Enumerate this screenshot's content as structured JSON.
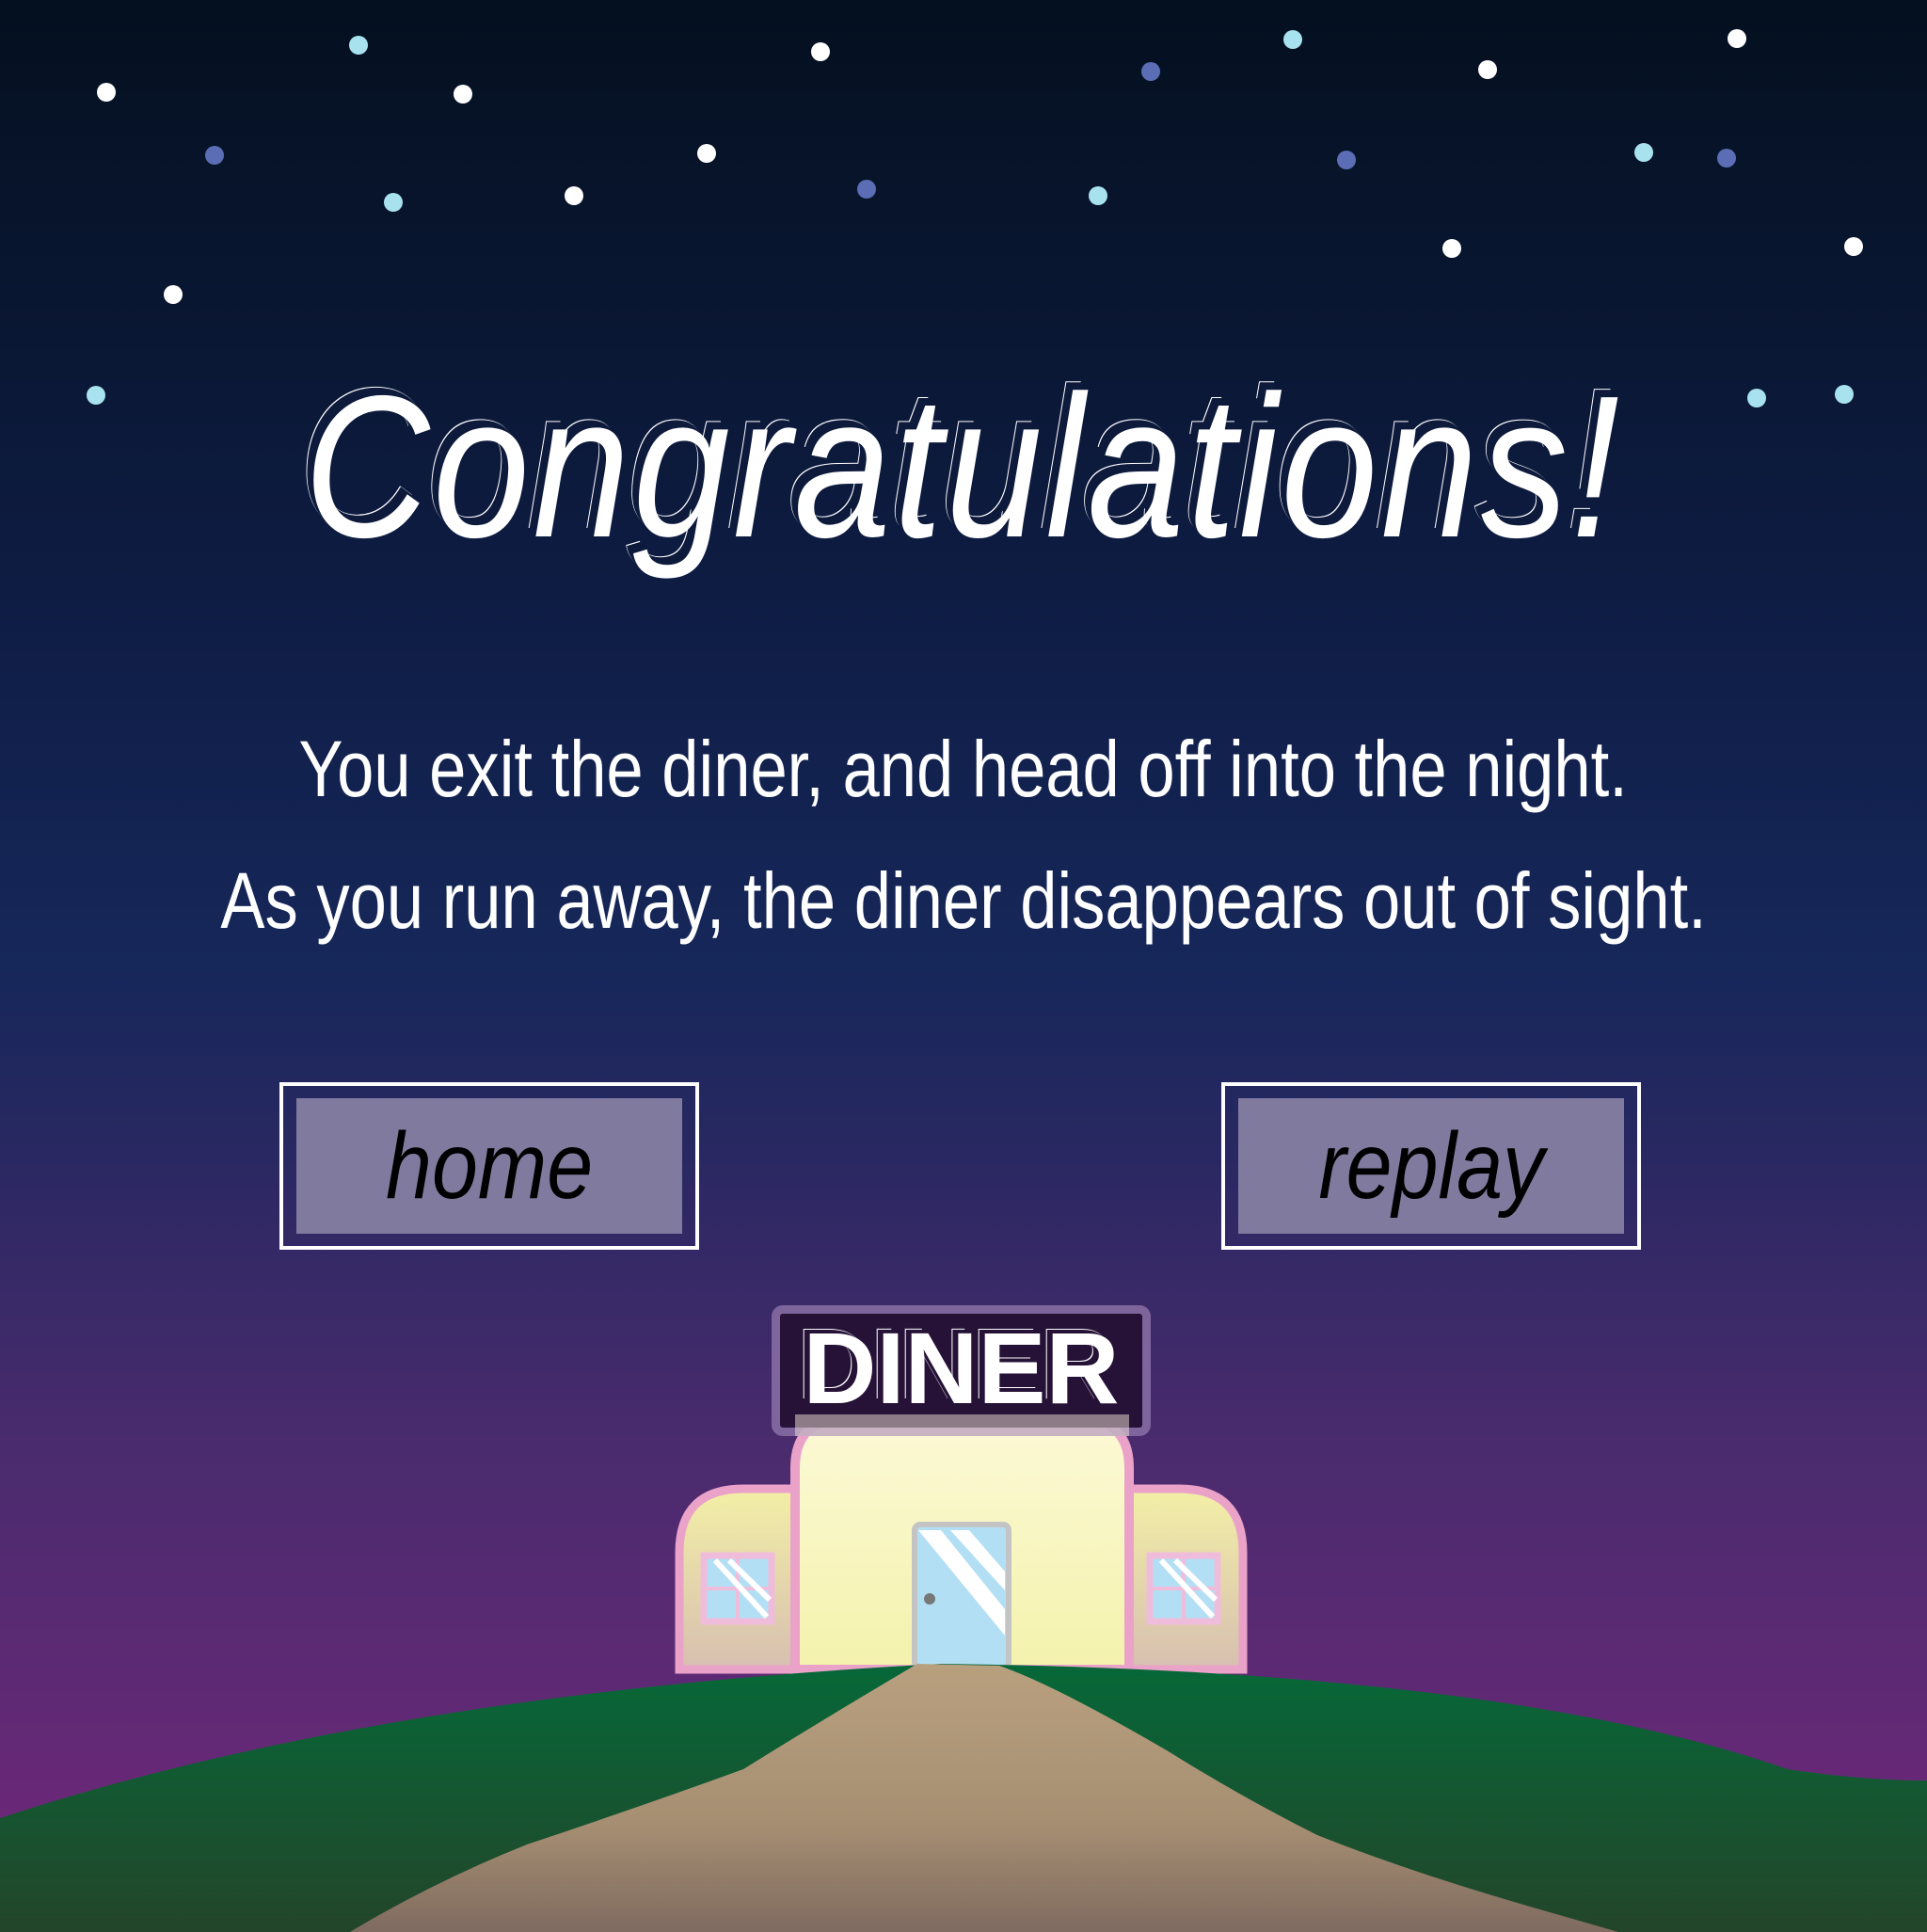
{
  "title": "Congratulations!",
  "message": {
    "line1": "You exit the diner, and head off into the night.",
    "line2": "As you run away, the diner disappears out of sight."
  },
  "buttons": {
    "home": "home",
    "replay": "replay"
  },
  "scene": {
    "sign": "DINER"
  },
  "colors": {
    "sky_top": "#04101f",
    "sky_mid": "#13204f",
    "sky_bottom": "#6b2878",
    "hill": "#066838",
    "path": "#b8a07f",
    "building": "#f7f3bd",
    "trim": "#eaa2c9",
    "door": "#b3dff4"
  }
}
